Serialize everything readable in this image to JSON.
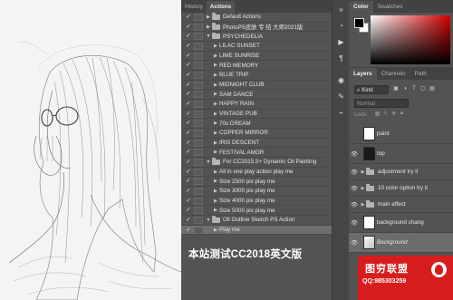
{
  "actions_panel": {
    "tabs": [
      "History",
      "Actions"
    ],
    "active_tab": "Actions",
    "menu_icon": "panel-menu-icon",
    "items": [
      {
        "label": "Default Actions",
        "kind": "set",
        "checked": true
      },
      {
        "label": "PhotoPS皮肤 专 结 大师2021版",
        "kind": "set",
        "checked": true
      },
      {
        "label": "PSYCHEDELIA",
        "kind": "set",
        "checked": true,
        "expanded": true
      },
      {
        "label": "LILAC SUNSET",
        "kind": "action",
        "checked": true
      },
      {
        "label": "LIME SUNRISE",
        "kind": "action",
        "checked": true
      },
      {
        "label": "RED MEMORY",
        "kind": "action",
        "checked": true
      },
      {
        "label": "BLUE TRIP",
        "kind": "action",
        "checked": true
      },
      {
        "label": "MIDNIGHT CLUB",
        "kind": "action",
        "checked": true
      },
      {
        "label": "SAM DANCE",
        "kind": "action",
        "checked": true
      },
      {
        "label": "HAPPY RAIN",
        "kind": "action",
        "checked": true
      },
      {
        "label": "VINTAGE PUB",
        "kind": "action",
        "checked": true
      },
      {
        "label": "70s DREAM",
        "kind": "action",
        "checked": true
      },
      {
        "label": "COPPER MIRROR",
        "kind": "action",
        "checked": true
      },
      {
        "label": "IRIS DESCENT",
        "kind": "action",
        "checked": true
      },
      {
        "label": "FESTIVAL AMOR",
        "kind": "action",
        "checked": true
      },
      {
        "label": "For CC2015.5+ Dynamic Oil Painting",
        "kind": "set",
        "checked": true,
        "expanded": true
      },
      {
        "label": "All in one play action play me",
        "kind": "action",
        "checked": true
      },
      {
        "label": "Size 2500 pix play me",
        "kind": "action",
        "checked": true
      },
      {
        "label": "Size 3000 pix play me",
        "kind": "action",
        "checked": true
      },
      {
        "label": "Size 4000 pix play me",
        "kind": "action",
        "checked": true
      },
      {
        "label": "Size 5000 pix play me",
        "kind": "action",
        "checked": true
      },
      {
        "label": "Oil Outline Sketch PS Action",
        "kind": "set",
        "checked": true,
        "expanded": true
      },
      {
        "label": "Play me",
        "kind": "action",
        "checked": true,
        "selected": true
      }
    ]
  },
  "overlay_caption": "本站测试CC2018英文版",
  "color_panel": {
    "tabs": [
      "Color",
      "Swatches"
    ],
    "active_tab": "Color",
    "foreground": "#000000",
    "background": "#ffffff",
    "hue_color": "#d00000"
  },
  "layers_panel": {
    "tabs": [
      "Layers",
      "Channels",
      "Path"
    ],
    "active_tab": "Layers",
    "filter_kind": "Kind",
    "blend_mode": "Normal",
    "lock_label": "Lock:",
    "layers": [
      {
        "label": "paint",
        "type": "layer",
        "thumb": "white",
        "visible": false
      },
      {
        "label": "top",
        "type": "layer",
        "thumb": "dark",
        "visible": true
      },
      {
        "label": "adjustment try it",
        "type": "group",
        "visible": true
      },
      {
        "label": "10 color option try it",
        "type": "group",
        "visible": true
      },
      {
        "label": "main effect",
        "type": "group",
        "visible": true
      },
      {
        "label": "background chang",
        "type": "layer",
        "thumb": "white",
        "visible": true
      },
      {
        "label": "Background",
        "type": "layer",
        "thumb": "photo",
        "visible": true,
        "italic": true,
        "selected": true
      }
    ]
  },
  "logo": {
    "title": "图穷联盟",
    "qq": "QQ:985303259",
    "color": "#d71d1d"
  }
}
